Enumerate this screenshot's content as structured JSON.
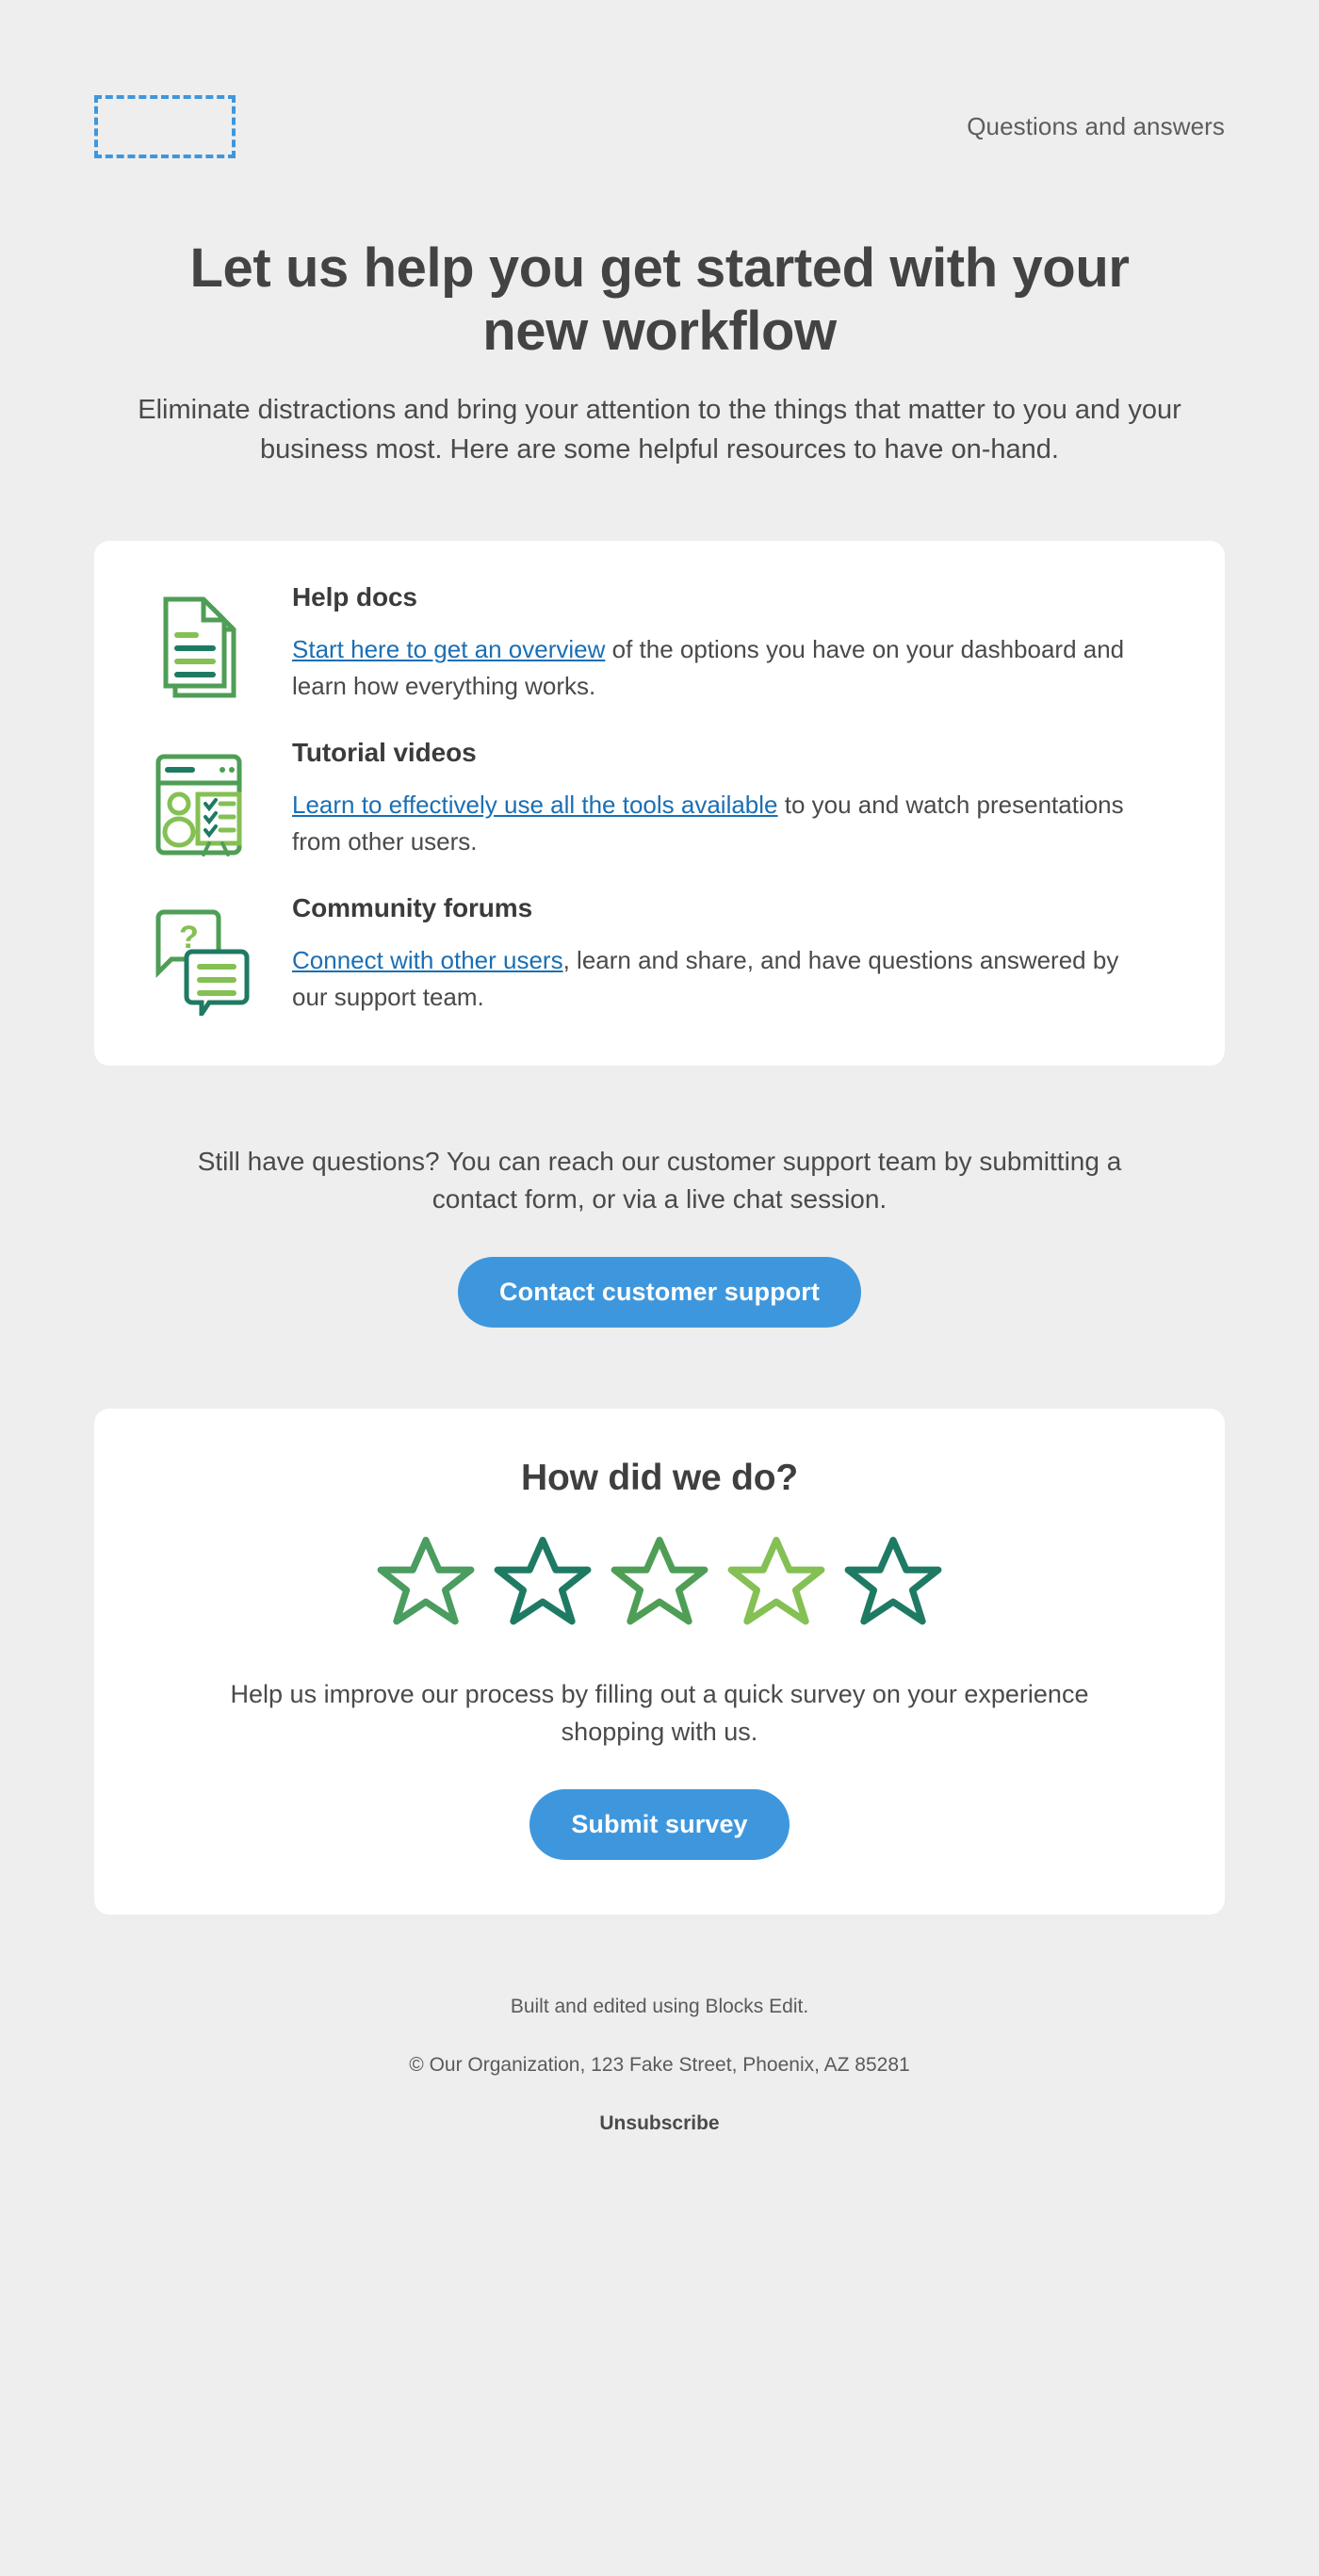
{
  "theme": {
    "page_background": "#eeeeee",
    "card_background": "#ffffff",
    "accent_blue": "#3e97dd",
    "link_blue": "#1a6fb5",
    "heading_gray": "#434343",
    "body_gray": "#4a4a4a"
  },
  "header": {
    "logo_placeholder_name": "logo-placeholder",
    "preheader_label": "Questions and answers"
  },
  "hero": {
    "title": "Let us help you get started with your new workflow",
    "subtitle": "Eliminate distractions and bring your attention to the things that matter to you and your business most. Here are some helpful resources to have on-hand."
  },
  "resources": [
    {
      "icon": "document-stack-icon",
      "title": "Help docs",
      "link_text": "Start here to get an overview",
      "rest_text": " of the options you have on your dashboard and learn how everything works."
    },
    {
      "icon": "tutorial-video-icon",
      "title": "Tutorial videos",
      "link_text": "Learn to effectively use all the tools available",
      "rest_text": " to you and watch presentations from other users."
    },
    {
      "icon": "chat-bubbles-icon",
      "title": "Community forums",
      "link_text": "Connect with other users",
      "rest_text": ", learn and share, and have questions answered by our support team."
    }
  ],
  "support": {
    "text": "Still have questions? You can reach our customer support team by submitting a contact form, or via a live chat session.",
    "button_label": "Contact customer support"
  },
  "survey": {
    "title": "How did we do?",
    "stars": [
      {
        "name": "star-1",
        "color": "#4a9c5f"
      },
      {
        "name": "star-2",
        "color": "#1f7a63"
      },
      {
        "name": "star-3",
        "color": "#4f9e56"
      },
      {
        "name": "star-4",
        "color": "#84c054"
      },
      {
        "name": "star-5",
        "color": "#1f7a63"
      }
    ],
    "text": "Help us improve our process by filling out a quick survey on your experience shopping with us.",
    "button_label": "Submit survey"
  },
  "footer": {
    "built_with": "Built and edited using Blocks Edit.",
    "copyright": "© Our Organization, 123 Fake Street, Phoenix, AZ 85281",
    "unsubscribe_label": "Unsubscribe"
  }
}
